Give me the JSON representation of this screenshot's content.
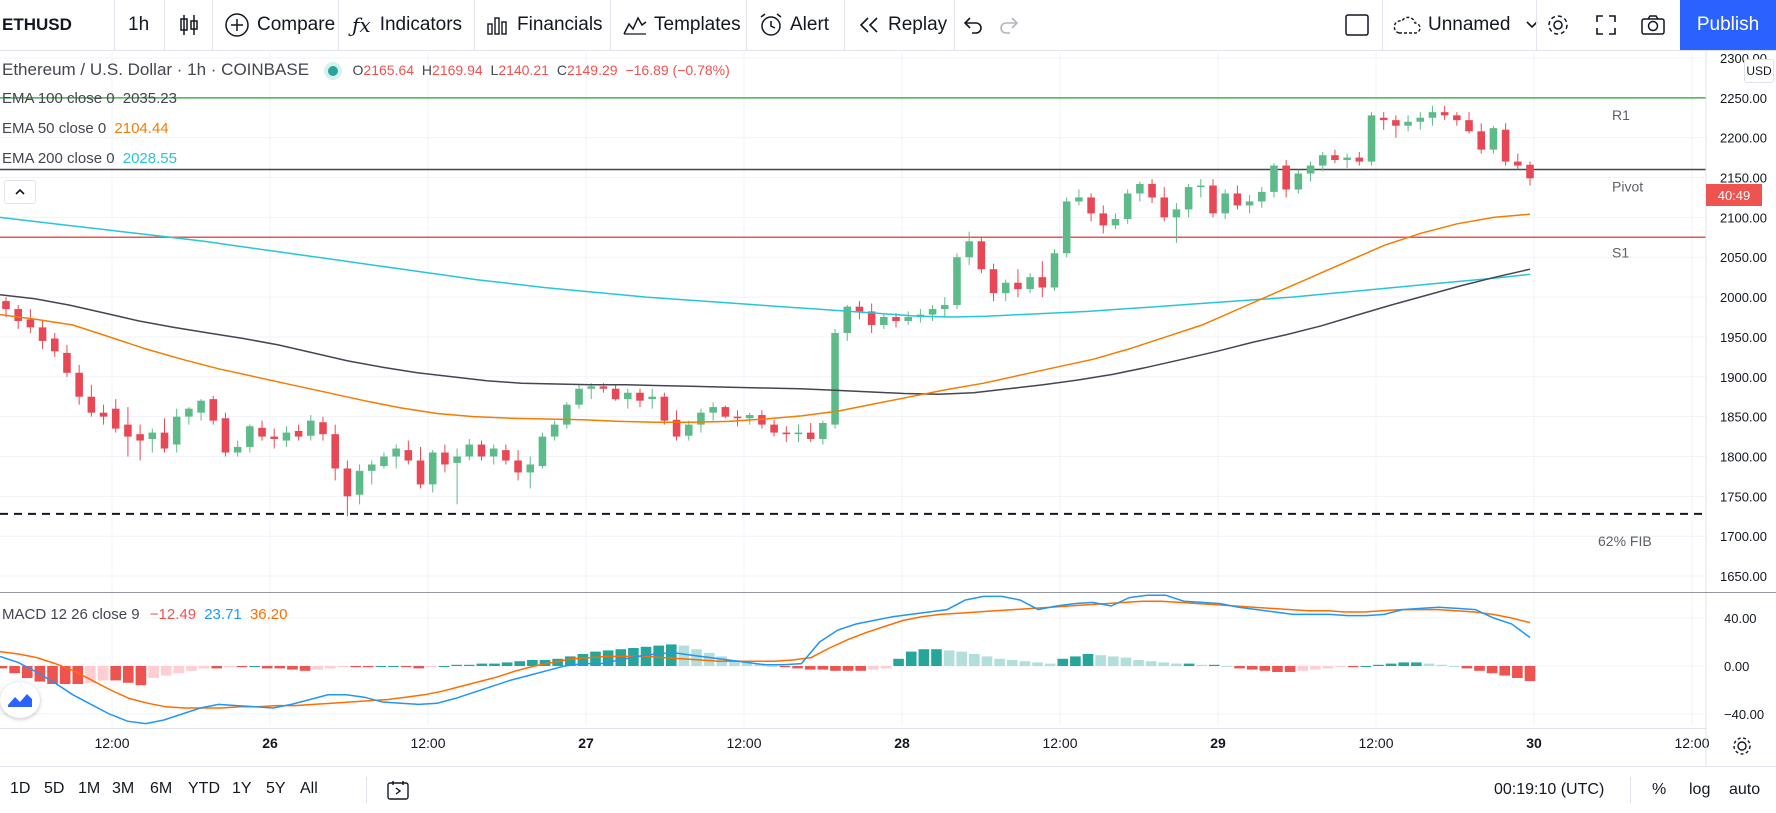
{
  "toolbar": {
    "symbol": "ETHUSD",
    "interval": "1h",
    "compare": "Compare",
    "indicators": "Indicators",
    "financials": "Financials",
    "templates": "Templates",
    "alert": "Alert",
    "replay": "Replay",
    "layout_name": "Unnamed",
    "publish": "Publish"
  },
  "legend": {
    "title": "Ethereum / U.S. Dollar · 1h · COINBASE",
    "o_label": "O",
    "o": "2165.64",
    "h_label": "H",
    "h": "2169.94",
    "l_label": "L",
    "l": "2140.21",
    "c_label": "C",
    "c": "2149.29",
    "change": "−16.89 (−0.78%)",
    "ema100_label": "EMA 100 close 0",
    "ema100": "2035.23",
    "ema50_label": "EMA 50 close 0",
    "ema50": "2104.44",
    "ema200_label": "EMA 200 close 0",
    "ema200": "2028.55",
    "macd_label": "MACD 12 26 close 9",
    "macd_hist": "−12.49",
    "macd_line": "23.71",
    "macd_signal": "36.20"
  },
  "price_axis": {
    "currency": "USD",
    "ticks": [
      "2300.00",
      "2250.00",
      "2200.00",
      "2150.00",
      "2100.00",
      "2050.00",
      "2000.00",
      "1950.00",
      "1900.00",
      "1850.00",
      "1800.00",
      "1750.00",
      "1700.00",
      "1650.00"
    ],
    "last_price_tag": "40:49"
  },
  "macd_axis": {
    "ticks": [
      "40.00",
      "0.00",
      "−40.00"
    ]
  },
  "time_axis": {
    "labels": [
      "12:00",
      "26",
      "12:00",
      "27",
      "12:00",
      "28",
      "12:00",
      "29",
      "12:00",
      "30",
      "12:00"
    ]
  },
  "levels": {
    "r1": "R1",
    "pivot": "Pivot",
    "s1": "S1",
    "fib": "62% FIB"
  },
  "bottom": {
    "ranges": [
      "1D",
      "5D",
      "1M",
      "3M",
      "6M",
      "YTD",
      "1Y",
      "5Y",
      "All"
    ],
    "clock": "00:19:10 (UTC)",
    "percent": "%",
    "log": "log",
    "auto": "auto"
  },
  "colors": {
    "up": "#26a69a",
    "up_body": "#5dbb8a",
    "down": "#ef5350",
    "down_body": "#e84855",
    "ema50": "#f57c00",
    "ema100": "#434651",
    "ema200": "#26c6da",
    "macd": "#2196f3",
    "signal": "#ff6d00",
    "accent": "#2962ff",
    "r1": "#4caf50",
    "s1": "#ef5350"
  },
  "chart_data": {
    "type": "candlestick",
    "symbol": "ETHUSD",
    "interval": "1h",
    "ylim": [
      1630,
      2310
    ],
    "macd_ylim": [
      -50,
      60
    ],
    "levels": {
      "r1": 2250,
      "pivot": 2160,
      "s1": 2075,
      "fib_62": 1728
    },
    "candles": [
      [
        1995,
        2000,
        1975,
        1985
      ],
      [
        1985,
        1990,
        1960,
        1970
      ],
      [
        1972,
        1985,
        1955,
        1962
      ],
      [
        1962,
        1970,
        1935,
        1945
      ],
      [
        1948,
        1955,
        1925,
        1932
      ],
      [
        1930,
        1940,
        1900,
        1905
      ],
      [
        1905,
        1915,
        1865,
        1875
      ],
      [
        1875,
        1890,
        1850,
        1855
      ],
      [
        1855,
        1865,
        1840,
        1850
      ],
      [
        1860,
        1872,
        1830,
        1835
      ],
      [
        1840,
        1862,
        1800,
        1825
      ],
      [
        1828,
        1840,
        1795,
        1820
      ],
      [
        1822,
        1835,
        1805,
        1830
      ],
      [
        1830,
        1848,
        1805,
        1810
      ],
      [
        1815,
        1860,
        1805,
        1850
      ],
      [
        1850,
        1862,
        1840,
        1860
      ],
      [
        1855,
        1872,
        1845,
        1870
      ],
      [
        1872,
        1876,
        1840,
        1845
      ],
      [
        1848,
        1855,
        1800,
        1805
      ],
      [
        1805,
        1820,
        1800,
        1812
      ],
      [
        1812,
        1840,
        1805,
        1838
      ],
      [
        1836,
        1845,
        1820,
        1825
      ],
      [
        1825,
        1835,
        1810,
        1822
      ],
      [
        1820,
        1838,
        1812,
        1830
      ],
      [
        1832,
        1840,
        1820,
        1825
      ],
      [
        1826,
        1852,
        1820,
        1845
      ],
      [
        1843,
        1850,
        1820,
        1828
      ],
      [
        1828,
        1840,
        1770,
        1785
      ],
      [
        1785,
        1795,
        1725,
        1750
      ],
      [
        1752,
        1790,
        1740,
        1782
      ],
      [
        1782,
        1795,
        1765,
        1790
      ],
      [
        1788,
        1805,
        1785,
        1800
      ],
      [
        1800,
        1815,
        1785,
        1810
      ],
      [
        1808,
        1820,
        1790,
        1795
      ],
      [
        1795,
        1812,
        1760,
        1765
      ],
      [
        1765,
        1808,
        1755,
        1805
      ],
      [
        1805,
        1815,
        1780,
        1790
      ],
      [
        1792,
        1810,
        1740,
        1800
      ],
      [
        1800,
        1822,
        1795,
        1815
      ],
      [
        1815,
        1820,
        1795,
        1800
      ],
      [
        1800,
        1815,
        1790,
        1810
      ],
      [
        1808,
        1815,
        1790,
        1795
      ],
      [
        1795,
        1808,
        1770,
        1780
      ],
      [
        1780,
        1800,
        1760,
        1790
      ],
      [
        1788,
        1830,
        1785,
        1825
      ],
      [
        1825,
        1845,
        1820,
        1840
      ],
      [
        1840,
        1868,
        1835,
        1865
      ],
      [
        1865,
        1890,
        1860,
        1885
      ],
      [
        1885,
        1892,
        1872,
        1888
      ],
      [
        1888,
        1892,
        1880,
        1885
      ],
      [
        1885,
        1890,
        1870,
        1872
      ],
      [
        1872,
        1885,
        1860,
        1880
      ],
      [
        1880,
        1885,
        1862,
        1870
      ],
      [
        1872,
        1885,
        1860,
        1875
      ],
      [
        1875,
        1880,
        1840,
        1845
      ],
      [
        1846,
        1858,
        1820,
        1825
      ],
      [
        1826,
        1845,
        1820,
        1840
      ],
      [
        1840,
        1860,
        1830,
        1855
      ],
      [
        1855,
        1868,
        1845,
        1862
      ],
      [
        1862,
        1864,
        1848,
        1850
      ],
      [
        1850,
        1858,
        1838,
        1848
      ],
      [
        1848,
        1855,
        1840,
        1852
      ],
      [
        1852,
        1858,
        1835,
        1840
      ],
      [
        1840,
        1846,
        1825,
        1830
      ],
      [
        1830,
        1838,
        1818,
        1828
      ],
      [
        1828,
        1840,
        1818,
        1830
      ],
      [
        1830,
        1842,
        1818,
        1822
      ],
      [
        1822,
        1845,
        1815,
        1842
      ],
      [
        1840,
        1960,
        1835,
        1955
      ],
      [
        1955,
        1990,
        1945,
        1988
      ],
      [
        1988,
        1995,
        1972,
        1982
      ],
      [
        1982,
        1992,
        1955,
        1965
      ],
      [
        1965,
        1980,
        1960,
        1975
      ],
      [
        1975,
        1980,
        1962,
        1970
      ],
      [
        1970,
        1982,
        1965,
        1975
      ],
      [
        1975,
        1985,
        1968,
        1978
      ],
      [
        1978,
        1990,
        1970,
        1985
      ],
      [
        1985,
        2000,
        1975,
        1990
      ],
      [
        1990,
        2055,
        1985,
        2050
      ],
      [
        2050,
        2082,
        2040,
        2070
      ],
      [
        2070,
        2075,
        2030,
        2035
      ],
      [
        2035,
        2042,
        1995,
        2005
      ],
      [
        2005,
        2022,
        1995,
        2018
      ],
      [
        2018,
        2035,
        2000,
        2010
      ],
      [
        2010,
        2030,
        2005,
        2025
      ],
      [
        2025,
        2045,
        2000,
        2012
      ],
      [
        2012,
        2060,
        2008,
        2055
      ],
      [
        2055,
        2125,
        2050,
        2120
      ],
      [
        2120,
        2135,
        2115,
        2125
      ],
      [
        2125,
        2130,
        2095,
        2105
      ],
      [
        2105,
        2115,
        2080,
        2090
      ],
      [
        2090,
        2105,
        2085,
        2098
      ],
      [
        2098,
        2135,
        2092,
        2130
      ],
      [
        2130,
        2145,
        2120,
        2142
      ],
      [
        2142,
        2148,
        2118,
        2125
      ],
      [
        2125,
        2138,
        2095,
        2100
      ],
      [
        2100,
        2118,
        2068,
        2110
      ],
      [
        2110,
        2142,
        2100,
        2138
      ],
      [
        2138,
        2148,
        2125,
        2140
      ],
      [
        2140,
        2148,
        2100,
        2105
      ],
      [
        2105,
        2135,
        2098,
        2130
      ],
      [
        2130,
        2140,
        2110,
        2115
      ],
      [
        2115,
        2128,
        2105,
        2120
      ],
      [
        2120,
        2138,
        2112,
        2132
      ],
      [
        2132,
        2168,
        2125,
        2165
      ],
      [
        2165,
        2172,
        2125,
        2135
      ],
      [
        2135,
        2160,
        2130,
        2155
      ],
      [
        2155,
        2170,
        2145,
        2165
      ],
      [
        2165,
        2182,
        2158,
        2178
      ],
      [
        2178,
        2185,
        2168,
        2172
      ],
      [
        2172,
        2180,
        2162,
        2175
      ],
      [
        2175,
        2182,
        2165,
        2170
      ],
      [
        2170,
        2232,
        2165,
        2228
      ],
      [
        2225,
        2232,
        2210,
        2222
      ],
      [
        2222,
        2228,
        2200,
        2215
      ],
      [
        2215,
        2228,
        2208,
        2220
      ],
      [
        2220,
        2232,
        2210,
        2225
      ],
      [
        2225,
        2240,
        2215,
        2232
      ],
      [
        2232,
        2240,
        2222,
        2228
      ],
      [
        2228,
        2232,
        2215,
        2222
      ],
      [
        2222,
        2232,
        2205,
        2208
      ],
      [
        2208,
        2218,
        2180,
        2185
      ],
      [
        2185,
        2215,
        2180,
        2212
      ],
      [
        2210,
        2218,
        2165,
        2170
      ],
      [
        2170,
        2180,
        2160,
        2165
      ],
      [
        2166,
        2170,
        2140,
        2149
      ]
    ],
    "ema50": [
      1978,
      1972,
      1965,
      1950,
      1935,
      1922,
      1910,
      1900,
      1890,
      1880,
      1870,
      1861,
      1854,
      1850,
      1848,
      1847,
      1846,
      1844,
      1843,
      1843,
      1844,
      1847,
      1851,
      1857,
      1866,
      1875,
      1884,
      1892,
      1902,
      1912,
      1922,
      1935,
      1950,
      1965,
      1985,
      2005,
      2025,
      2045,
      2065,
      2080,
      2092,
      2100,
      2104
    ],
    "ema100": [
      2003,
      1998,
      1990,
      1980,
      1970,
      1962,
      1955,
      1948,
      1940,
      1930,
      1920,
      1912,
      1905,
      1900,
      1895,
      1892,
      1891,
      1890,
      1890,
      1889,
      1888,
      1887,
      1886,
      1885,
      1883,
      1881,
      1879,
      1878,
      1880,
      1885,
      1890,
      1896,
      1903,
      1912,
      1922,
      1932,
      1943,
      1953,
      1964,
      1977,
      1990,
      2002,
      2014,
      2025,
      2035
    ],
    "ema200": [
      2100,
      2095,
      2090,
      2085,
      2080,
      2075,
      2070,
      2064,
      2058,
      2052,
      2046,
      2040,
      2034,
      2028,
      2022,
      2017,
      2012,
      2008,
      2004,
      2000,
      1997,
      1994,
      1991,
      1988,
      1985,
      1982,
      1979,
      1976,
      1975,
      1976,
      1978,
      1980,
      1982,
      1985,
      1988,
      1991,
      1994,
      1997,
      2000,
      2004,
      2008,
      2012,
      2016,
      2020,
      2024,
      2028.55
    ],
    "macd_line": [
      8,
      3,
      -5,
      -14,
      -24,
      -32,
      -40,
      -46,
      -48,
      -45,
      -40,
      -35,
      -32,
      -33,
      -34,
      -35,
      -32,
      -28,
      -24,
      -24,
      -26,
      -30,
      -31,
      -32,
      -31,
      -27,
      -22,
      -17,
      -12,
      -8,
      -4,
      0,
      2,
      2,
      5,
      8,
      10,
      11,
      9,
      7,
      5,
      3,
      1,
      1,
      2,
      20,
      30,
      35,
      38,
      41,
      43,
      45,
      47,
      55,
      58,
      58,
      55,
      47,
      50,
      52,
      53,
      50,
      57,
      59,
      59,
      54,
      53,
      52,
      49,
      47,
      45,
      43,
      43,
      43,
      42,
      42,
      43,
      47,
      48,
      49,
      48,
      47,
      40,
      35,
      23.71
    ],
    "macd_signal": [
      12,
      10,
      7,
      2,
      -4,
      -12,
      -20,
      -27,
      -31,
      -34,
      -35,
      -35,
      -35,
      -34,
      -34,
      -33,
      -33,
      -32,
      -31,
      -30,
      -29,
      -28,
      -26,
      -24,
      -21,
      -17,
      -13,
      -9,
      -4,
      0,
      3,
      6,
      7,
      8,
      8,
      8,
      7,
      6,
      5,
      4,
      4,
      4,
      4,
      5,
      7,
      15,
      22,
      28,
      33,
      38,
      41,
      43,
      44,
      45,
      46,
      47,
      48,
      49,
      50,
      51,
      52,
      53,
      54,
      54,
      53,
      52,
      51,
      50,
      49,
      48,
      47,
      46,
      46,
      45,
      45,
      46,
      47,
      47,
      47,
      46,
      45,
      43,
      40,
      36.2
    ],
    "macd_histogram": [
      -2,
      -6,
      -10,
      -13,
      -15,
      -15,
      -15,
      -14,
      -12,
      -12,
      -14,
      -16,
      -10,
      -8,
      -6,
      -4,
      -2,
      -2,
      -1,
      -1,
      0,
      -2,
      -2,
      -3,
      -4,
      -3,
      -2,
      -1,
      -1,
      -1,
      0,
      0,
      -1,
      -2,
      -1,
      0,
      1,
      1,
      2,
      2,
      3,
      4,
      5,
      5,
      6,
      8,
      10,
      12,
      13,
      14,
      15,
      16,
      17,
      18,
      17,
      14,
      11,
      8,
      5,
      3,
      2,
      0,
      -1,
      -2,
      -3,
      -3,
      -4,
      -4,
      -4,
      -3,
      -2,
      6,
      12,
      14,
      14,
      13,
      12,
      10,
      8,
      6,
      5,
      4,
      3,
      2,
      6,
      8,
      10,
      9,
      8,
      7,
      5,
      4,
      3,
      2,
      2,
      1,
      1,
      0,
      -2,
      -3,
      -4,
      -5,
      -5,
      -4,
      -3,
      -2,
      -1,
      -1,
      0,
      1,
      2,
      3,
      3,
      2,
      1,
      0,
      -2,
      -4,
      -6,
      -8,
      -10,
      -12.49
    ]
  }
}
